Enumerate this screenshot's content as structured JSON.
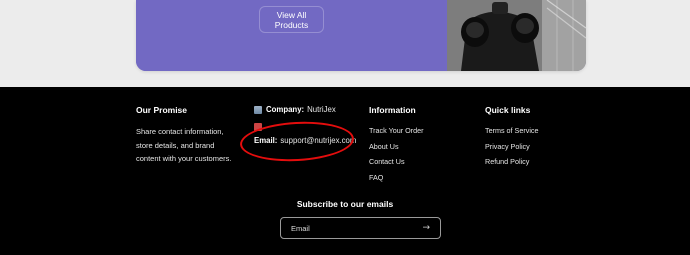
{
  "promo": {
    "button_label": "View All Products"
  },
  "footer": {
    "our_promise": {
      "heading": "Our Promise",
      "text": "Share contact information, store details, and brand content with your customers."
    },
    "contact": {
      "company_label": "Company:",
      "company_value": "NutriJex",
      "email_label": "Email:",
      "email_value": "support@nutrijex.com",
      "company_icon": "building-emoji-icon",
      "email_icon": "envelope-emoji-icon"
    },
    "information": {
      "heading": "Information",
      "links": [
        "Track Your Order",
        "About Us",
        "Contact Us",
        "FAQ"
      ]
    },
    "quick_links": {
      "heading": "Quick links",
      "links": [
        "Terms of Service",
        "Privacy Policy",
        "Refund Policy"
      ]
    },
    "subscribe": {
      "heading": "Subscribe to our emails",
      "placeholder": "Email",
      "submit_icon": "arrow-right-icon"
    },
    "annotation_color": "#e40d0d"
  }
}
